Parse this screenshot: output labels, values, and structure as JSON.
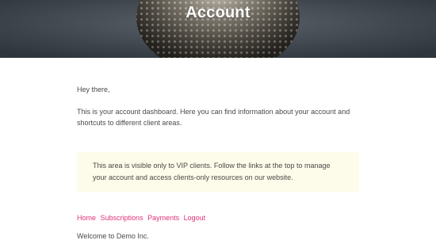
{
  "header": {
    "title": "Account"
  },
  "main": {
    "greeting": "Hey there,",
    "intro": "This is your account dashboard. Here you can find information about your account and shortcuts to different client areas.",
    "vip_notice": "This area is visible only to VIP clients. Follow the links at the top to manage your account and access clients-only resources on our website.",
    "nav_links": [
      {
        "label": "Home"
      },
      {
        "label": "Subscriptions"
      },
      {
        "label": "Payments"
      },
      {
        "label": "Logout"
      }
    ],
    "welcome": "Welcome to Demo Inc."
  },
  "colors": {
    "link": "#e0317a",
    "notice_background": "#fdfbe9",
    "hero_background": "#3d444d"
  },
  "icons": {
    "hero": "sea-urchin-photo"
  }
}
